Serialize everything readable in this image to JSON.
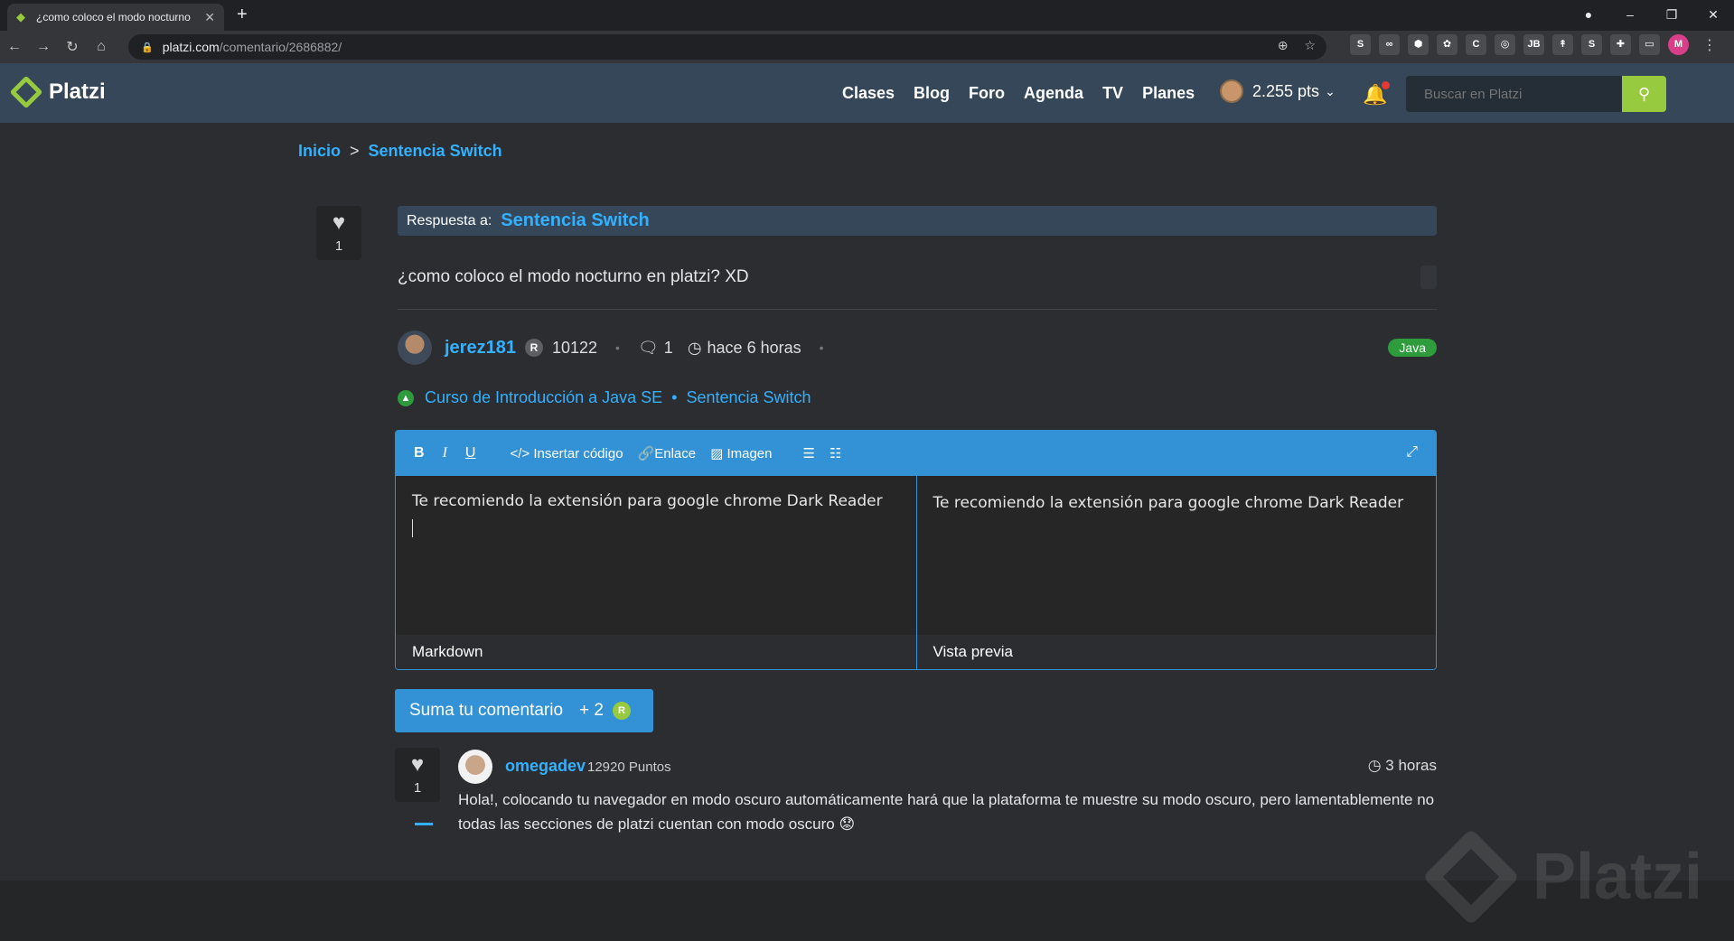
{
  "browser": {
    "tab_title": "¿como coloco el modo nocturno",
    "url_domain": "platzi.com",
    "url_path": "/comentario/2686882/",
    "extensions": [
      "S",
      "∞",
      "⬢",
      "✿",
      "C",
      "◎",
      "JB",
      "↟",
      "S",
      "✚",
      "▭",
      "M"
    ]
  },
  "header": {
    "logo": "Platzi",
    "nav": [
      "Clases",
      "Blog",
      "Foro",
      "Agenda",
      "TV",
      "Planes"
    ],
    "points": "2.255 pts",
    "search_placeholder": "Buscar en Platzi"
  },
  "breadcrumb": {
    "home": "Inicio",
    "separator": ">",
    "current": "Sentencia Switch"
  },
  "question": {
    "likes": "1",
    "reply_to_label": "Respuesta a:",
    "reply_to_link": "Sentencia Switch",
    "text": "¿como coloco el modo nocturno en platzi? XD",
    "author": "jerez181",
    "author_badge": "R",
    "author_points": "10122",
    "comments": "1",
    "time": "hace 6 horas",
    "tag": "Java",
    "course": "Curso de Introducción a Java SE",
    "course_bullet": "•",
    "lesson": "Sentencia Switch"
  },
  "editor": {
    "bold": "B",
    "italic": "I",
    "underline": "U",
    "insert_code": "Insertar código",
    "link": "Enlace",
    "image": "Imagen",
    "markdown_text": "Te recomiendo la extensión para google chrome Dark Reader",
    "preview_text": "Te recomiendo la extensión para google chrome Dark Reader",
    "markdown_label": "Markdown",
    "preview_label": "Vista previa"
  },
  "submit": {
    "label": "Suma tu comentario",
    "bonus": "+ 2",
    "coin": "R"
  },
  "reply": {
    "likes": "1",
    "author": "omegadev",
    "points": "12920 Puntos",
    "time": "3 horas",
    "text": "Hola!, colocando tu navegador en modo oscuro automáticamente hará que la plataforma te muestre su modo oscuro, pero lamentablemente no todas las secciones de platzi cuentan con modo oscuro 😟"
  },
  "watermark": "Platzi",
  "colors": {
    "accent_green": "#98ca3f",
    "link_blue": "#33b1ff",
    "editor_blue": "#3391d6",
    "header_bg": "#36475a"
  }
}
